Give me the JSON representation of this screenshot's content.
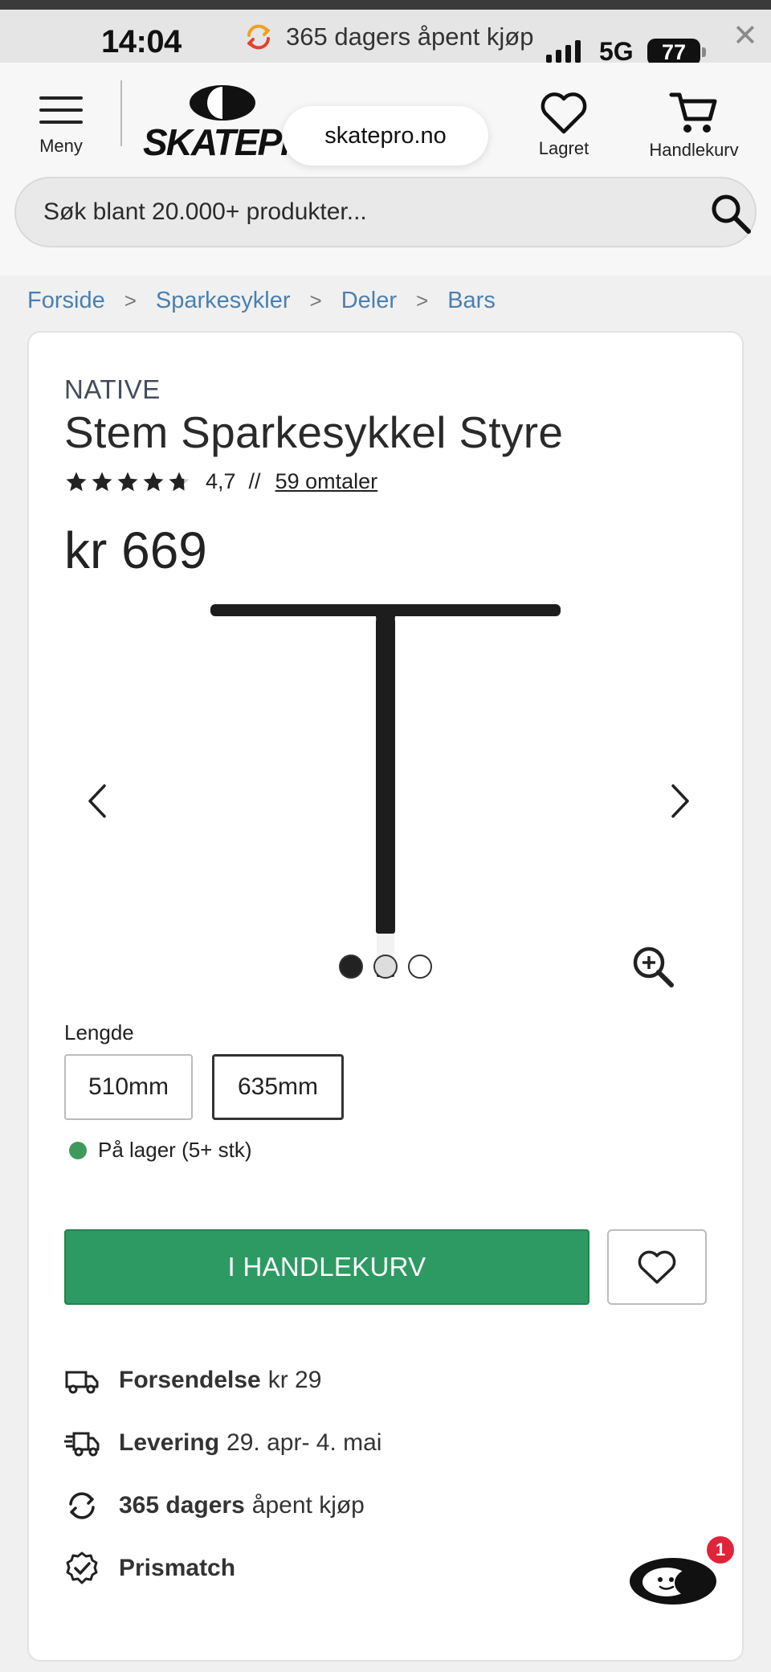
{
  "status_bar": {
    "time": "14:04",
    "promo_text": "365 dagers åpent kjøp",
    "network": "5G",
    "battery": "77"
  },
  "header": {
    "menu_label": "Meny",
    "logo_text": "SKATEPRO",
    "url": "skatepro.no",
    "saved_label": "Lagret",
    "cart_label": "Handlekurv",
    "search_placeholder": "Søk blant 20.000+ produkter..."
  },
  "breadcrumb": [
    "Forside",
    "Sparkesykler",
    "Deler",
    "Bars"
  ],
  "product": {
    "brand": "NATIVE",
    "title": "Stem Sparkesykkel Styre",
    "rating_value": "4,7",
    "rating_stars": 4.7,
    "separator": "//",
    "reviews_label": "59 omtaler",
    "price": "kr 669",
    "gallery": {
      "image_count": 3,
      "active_index": 0
    },
    "option_label": "Lengde",
    "options": [
      "510mm",
      "635mm"
    ],
    "selected_option": "635mm",
    "stock_text": "På lager (5+ stk)",
    "stock_color": "#3d9a5c",
    "add_to_cart_label": "I HANDLEKURV",
    "accent_color": "#2e9a63"
  },
  "features": [
    {
      "icon": "truck-icon",
      "bold": "Forsendelse",
      "text": "kr 29"
    },
    {
      "icon": "fast-delivery-icon",
      "bold": "Levering",
      "text": "29. apr- 4. mai"
    },
    {
      "icon": "return-icon",
      "bold": "365 dagers",
      "text": "åpent kjøp"
    },
    {
      "icon": "price-match-icon",
      "bold": "Prismatch",
      "text": ""
    }
  ],
  "chat": {
    "badge_count": "1"
  }
}
